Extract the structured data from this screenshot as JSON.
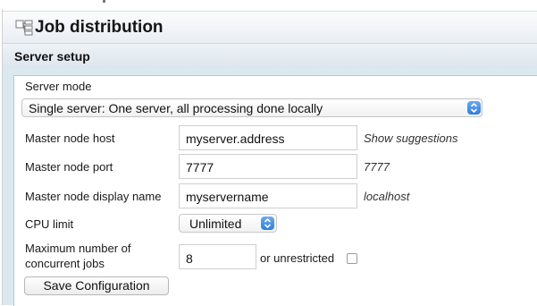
{
  "page": {
    "title": "Job distribution",
    "icon": "job-distribution-icon"
  },
  "server_setup": {
    "section_title": "Server setup",
    "server_mode": {
      "label": "Server mode",
      "selected": "Single server: One server, all processing done locally",
      "icon": "select-stepper-icon"
    },
    "master_node_host": {
      "label": "Master node host",
      "value": "myserver.address",
      "hint": "Show suggestions"
    },
    "master_node_port": {
      "label": "Master node port",
      "value": "7777",
      "hint": "7777"
    },
    "master_node_display_name": {
      "label": "Master node display name",
      "value": "myservername",
      "hint": "localhost"
    },
    "cpu_limit": {
      "label": "CPU limit",
      "selected": "Unlimited"
    },
    "max_concurrent_jobs": {
      "label_line1": "Maximum number of",
      "label_line2": "concurrent jobs",
      "value": "8",
      "unrestricted_label": "or unrestricted",
      "unrestricted_checked": false
    },
    "save_label": "Save Configuration"
  },
  "colors": {
    "accent_blue": "#2f7ee1",
    "panel_border": "#a8cce2",
    "header_bg": "#e3e9ee"
  }
}
